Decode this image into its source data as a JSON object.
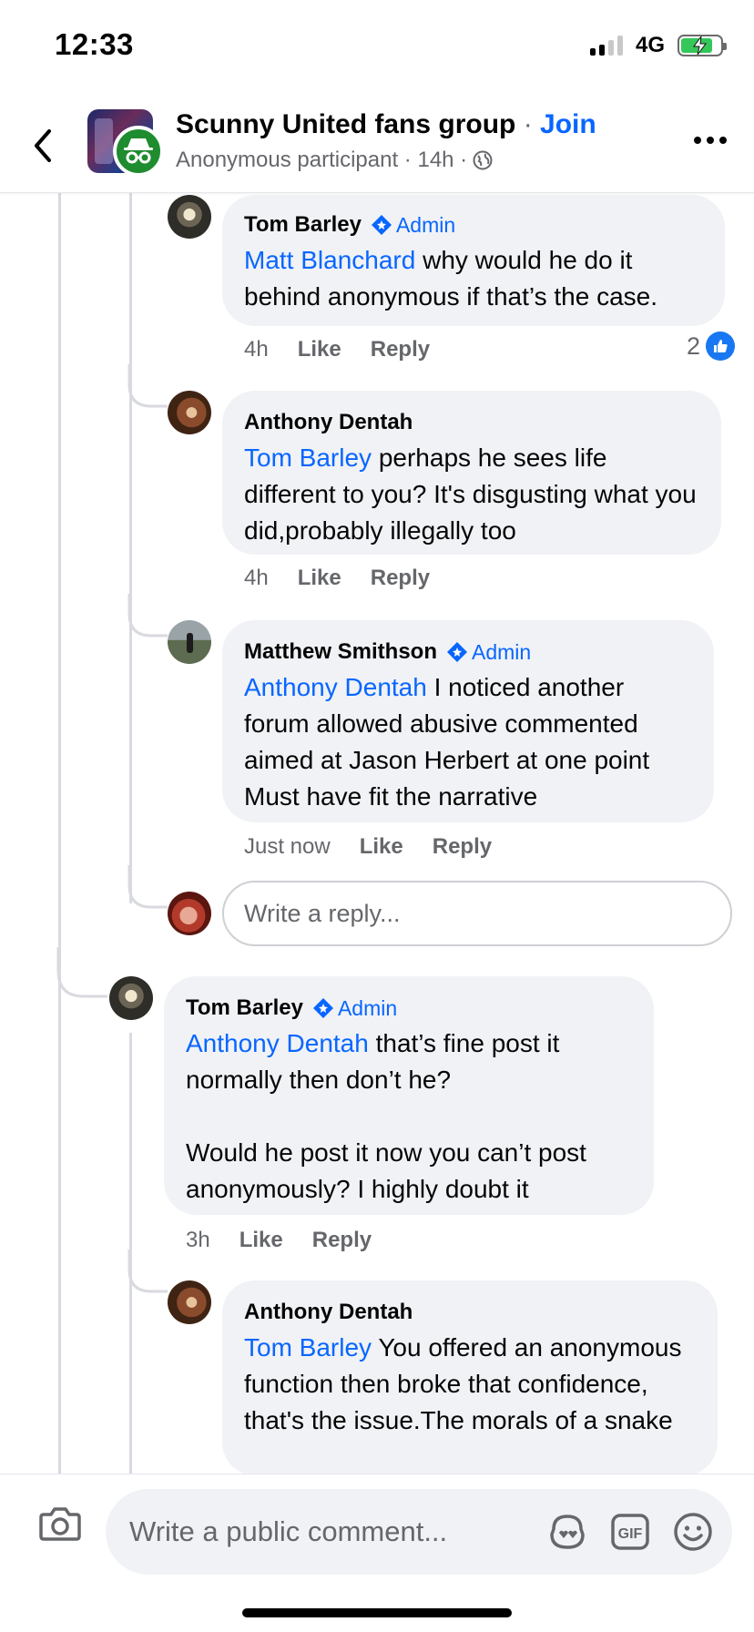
{
  "status": {
    "time": "12:33",
    "network": "4G"
  },
  "header": {
    "title": "Scunny United fans group",
    "separator": "·",
    "join_label": "Join",
    "subtitle": "Anonymous participant · 14h ·",
    "back_icon": "chevron-left-icon",
    "more_icon": "more-horizontal-icon"
  },
  "admin_label": "Admin",
  "comments": [
    {
      "name": "Tom Barley",
      "admin": true,
      "mention": "Matt Blanchard",
      "text": " why would he do it behind anonymous if that’s the case.",
      "time": "4h",
      "like": "Like",
      "reply": "Reply",
      "reactions": "2"
    },
    {
      "name": "Anthony Dentah",
      "admin": false,
      "mention": "Tom Barley",
      "text": " perhaps he sees life different to you? It's disgusting what you did,probably illegally too",
      "time": "4h",
      "like": "Like",
      "reply": "Reply"
    },
    {
      "name": "Matthew Smithson",
      "admin": true,
      "mention": "Anthony Dentah",
      "text": " I noticed another forum allowed abusive commented aimed at Jason Herbert at one point Must have fit the narrative",
      "time": "Just now",
      "like": "Like",
      "reply": "Reply"
    },
    {
      "name": "Tom Barley",
      "admin": true,
      "mention": "Anthony Dentah",
      "text": " that’s fine post it normally then don’t he?\n\nWould he post it now you can’t post anonymously? I highly doubt it",
      "time": "3h",
      "like": "Like",
      "reply": "Reply"
    },
    {
      "name": "Anthony Dentah",
      "admin": false,
      "mention": "Tom Barley",
      "text": " You offered an anonymous function then broke that confidence, that's the issue.The morals of a snake"
    }
  ],
  "reply_placeholder": "Write a reply...",
  "bottom": {
    "placeholder": "Write a public comment...",
    "gif_label": "GIF"
  },
  "colors": {
    "accent": "#0866ff",
    "bubble": "#f0f2f5",
    "muted": "#65676b",
    "anon_green": "#1f8c2f"
  }
}
